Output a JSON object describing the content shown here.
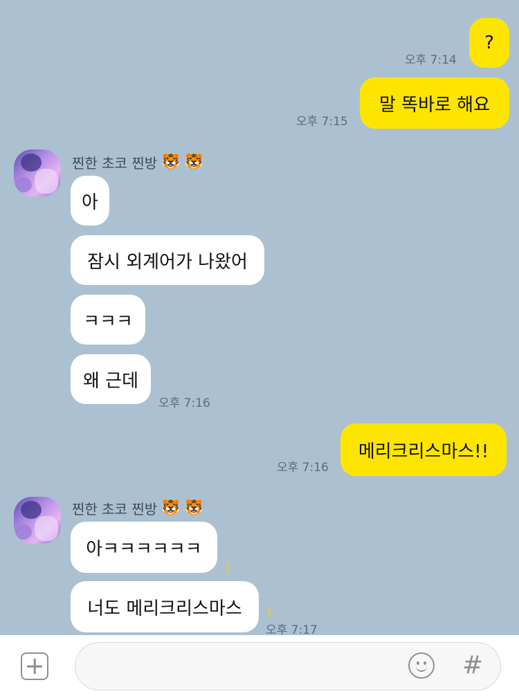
{
  "chat": {
    "sender_name": "찐한 초코 찐방",
    "sender_emojis": [
      "🐯",
      "🐯"
    ],
    "messages": [
      {
        "text": "?",
        "time": "오후 7:14"
      },
      {
        "text": "말 똑바로 해요",
        "time": "오후 7:15"
      },
      {
        "text": "아"
      },
      {
        "text": "잠시 외계어가 나왔어"
      },
      {
        "text": "ㅋㅋㅋ"
      },
      {
        "text": "왜 근데",
        "time": "오후 7:16"
      },
      {
        "text": "메리크리스마스!!",
        "time": "오후 7:16"
      },
      {
        "text": "아ㅋㅋㅋㅋㅋㅋ",
        "unread": "1"
      },
      {
        "text": "너도 메리크리스마스",
        "unread": "1",
        "time": "오후 7:17"
      }
    ]
  },
  "input_bar": {
    "placeholder": "",
    "hash_label": "#"
  },
  "colors": {
    "background": "#abc1d1",
    "my_bubble": "#fee500",
    "their_bubble": "#ffffff",
    "unread": "#f2d100"
  }
}
